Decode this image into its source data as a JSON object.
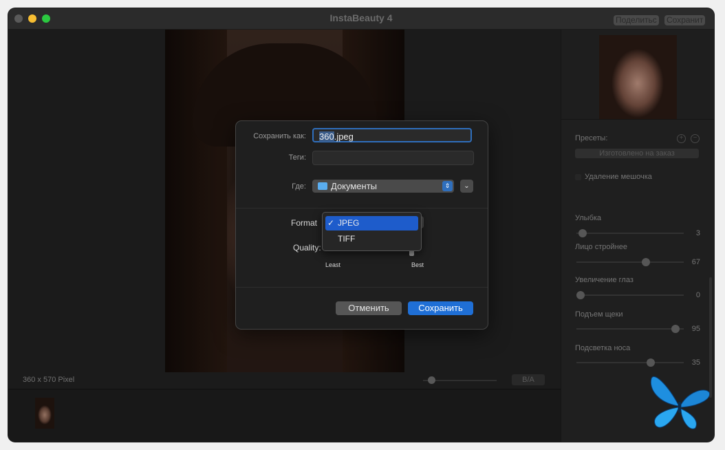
{
  "window": {
    "title": "InstaBeauty 4"
  },
  "toolbar": {
    "share_label": "Поделитьс",
    "save_label": "Сохранит"
  },
  "canvas": {
    "image_size": "360 x 570 Pixel",
    "ba_label": "B/A"
  },
  "sidebar": {
    "presets_label": "Пресеты:",
    "preset_value": "Изготовлено на заказ",
    "checkbox_label": "Удаление мешочка",
    "sliders": [
      {
        "label": "Улыбка",
        "value": "3",
        "fraction": 0.06
      },
      {
        "label": "Лицо стройнее",
        "value": "67",
        "fraction": 0.65
      },
      {
        "label": "Увеличение глаз",
        "value": "0",
        "fraction": 0.04
      },
      {
        "label": "Подъем щеки",
        "value": "95",
        "fraction": 0.92
      },
      {
        "label": "Подсветка носа",
        "value": "35",
        "fraction": 0.69
      }
    ]
  },
  "dialog": {
    "save_as_label": "Сохранить как:",
    "filename_selected": "360",
    "filename_ext": ".jpeg",
    "tags_label": "Теги:",
    "where_label": "Где:",
    "where_value": "Документы",
    "format_label": "Format",
    "quality_label": "Quality:",
    "quality_least": "Least",
    "quality_best": "Best",
    "format_options": [
      {
        "label": "JPEG",
        "selected": true
      },
      {
        "label": "TIFF",
        "selected": false
      }
    ],
    "check_mark": "✓",
    "cancel_label": "Отменить",
    "save_label": "Сохранить"
  },
  "colors": {
    "accent": "#1f6fd6",
    "folder": "#5aaef0"
  }
}
